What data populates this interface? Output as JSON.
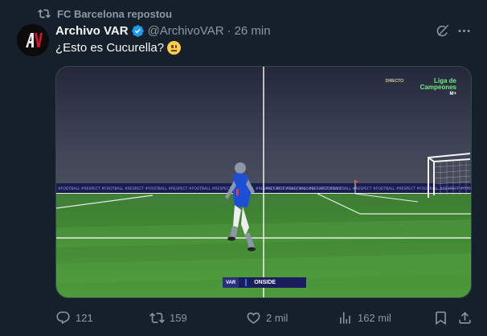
{
  "repost": {
    "icon": "repost-icon",
    "label": "FC Barcelona repostou"
  },
  "author": {
    "name": "Archivo VAR",
    "handle": "@ArchivoVAR",
    "separator": "·",
    "time": "26 min",
    "verified": true,
    "avatar_text": "AV"
  },
  "tweet": {
    "text": "¿Esto es Cucurella?",
    "emoji": "neutral-face-emoji"
  },
  "media": {
    "broadcast_live": "DIRECTO",
    "broadcast_title_1": "Liga de",
    "broadcast_title_2": "Campeones",
    "broadcast_channel": "M+",
    "var_tag": "VAR",
    "var_label": "ONSIDE",
    "board_text": "#FOOTBALL  #RESPECT"
  },
  "actions": {
    "replies": "121",
    "reposts": "159",
    "likes": "2 mil",
    "views": "162 mil"
  },
  "colors": {
    "background": "#15202b",
    "muted": "#8b98a5",
    "verified": "#1d9bf0",
    "pitch": "#3f8a34"
  }
}
